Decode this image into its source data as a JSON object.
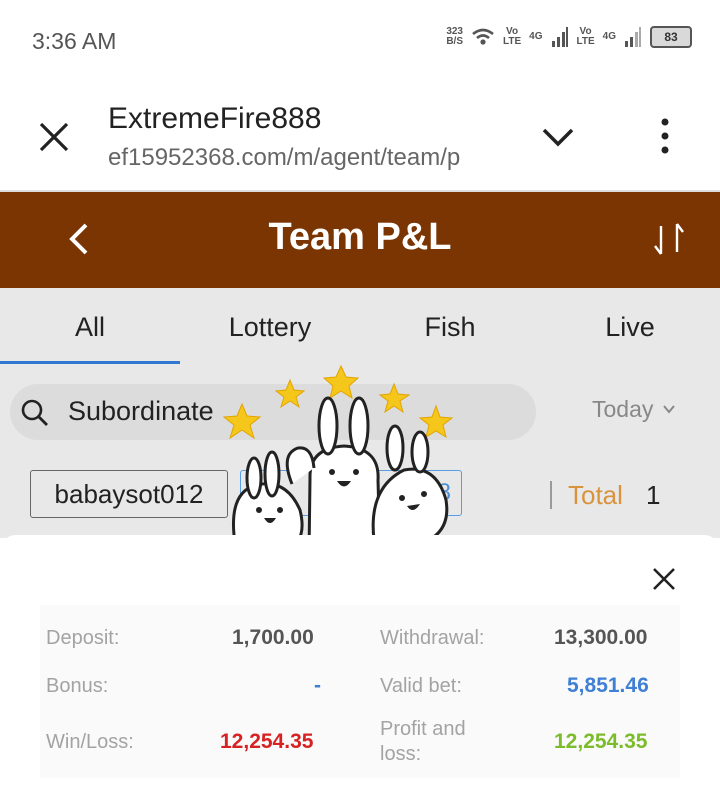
{
  "status_bar": {
    "time": "3:36 AM",
    "network_speed_value": "323",
    "network_speed_unit": "B/S",
    "vo_label": "Vo",
    "lte_label": "LTE",
    "g_label": "4G",
    "battery": "83"
  },
  "browser": {
    "title": "ExtremeFire888",
    "url": "ef15952368.com/m/agent/team/p"
  },
  "header": {
    "title": "Team P&L",
    "color": "#7a3503"
  },
  "tabs": [
    {
      "label": "All",
      "active": true
    },
    {
      "label": "Lottery",
      "active": false
    },
    {
      "label": "Fish",
      "active": false
    },
    {
      "label": "Live",
      "active": false
    }
  ],
  "search": {
    "placeholder": "Subordinate",
    "date_filter": "Today"
  },
  "filters": {
    "username": "babaysot012",
    "second_value": "8",
    "total_label": "Total",
    "total_value": "1"
  },
  "details": {
    "rows": [
      [
        {
          "label": "Deposit:",
          "value": "1,700.00",
          "color": "#555555"
        },
        {
          "label": "Withdrawal:",
          "value": "13,300.00",
          "color": "#555555"
        }
      ],
      [
        {
          "label": "Bonus:",
          "value": "-",
          "color": "#3f7fd4"
        },
        {
          "label": "Valid bet:",
          "value": "5,851.46",
          "color": "#3f7fd4"
        }
      ],
      [
        {
          "label": "Win/Loss:",
          "value": "12,254.35",
          "color": "#d62222"
        },
        {
          "label": "Profit and loss:",
          "value": "12,254.35",
          "color": "#7cbc2a"
        }
      ]
    ]
  }
}
